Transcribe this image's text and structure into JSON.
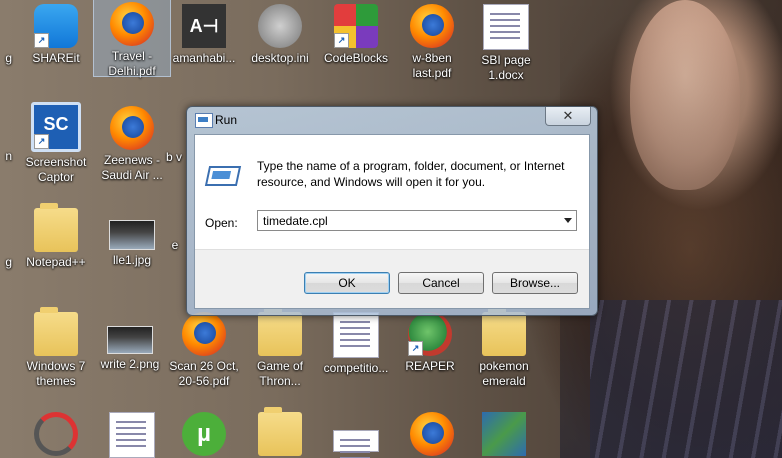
{
  "desktop": {
    "icons": [
      {
        "label": "g",
        "icon": "folder-icon"
      },
      {
        "label": "SHAREit",
        "icon": "shareit-icon"
      },
      {
        "label": "Travel - Delhi.pdf",
        "icon": "firefox-pdf-icon"
      },
      {
        "label": "amanhabi...",
        "icon": "ah-app-icon"
      },
      {
        "label": "desktop.ini",
        "icon": "settings-file-icon"
      },
      {
        "label": "CodeBlocks",
        "icon": "codeblocks-icon"
      },
      {
        "label": "w-8ben last.pdf",
        "icon": "firefox-pdf-icon"
      },
      {
        "label": "SBI page 1.docx",
        "icon": "word-doc-icon"
      },
      {
        "label": "n",
        "icon": "app-icon"
      },
      {
        "label": "Screenshot Captor",
        "icon": "screenshot-captor-icon"
      },
      {
        "label": "Zeenews - Saudi Air ...",
        "icon": "firefox-pdf-icon"
      },
      {
        "label": "b v",
        "icon": "app-icon"
      },
      {
        "label": "g",
        "icon": "app-icon"
      },
      {
        "label": "Notepad++",
        "icon": "folder-icon"
      },
      {
        "label": "lle1.jpg",
        "icon": "image-file-icon"
      },
      {
        "label": "e",
        "icon": "app-icon"
      },
      {
        "label": "Windows 7 themes",
        "icon": "folder-icon"
      },
      {
        "label": "write 2.png",
        "icon": "image-file-icon"
      },
      {
        "label": "Scan 26 Oct, 20-56.pdf",
        "icon": "firefox-pdf-icon"
      },
      {
        "label": "Game of Thron...",
        "icon": "folder-icon"
      },
      {
        "label": "competitio...",
        "icon": "image-file-icon"
      },
      {
        "label": "REAPER",
        "icon": "reaper-icon"
      },
      {
        "label": "pokemon emerald",
        "icon": "folder-icon"
      }
    ]
  },
  "run_dialog": {
    "title": "Run",
    "close_glyph": "✕",
    "description": "Type the name of a program, folder, document, or Internet resource, and Windows will open it for you.",
    "open_label": "Open:",
    "open_value": "timedate.cpl",
    "ok_label": "OK",
    "cancel_label": "Cancel",
    "browse_label": "Browse..."
  }
}
